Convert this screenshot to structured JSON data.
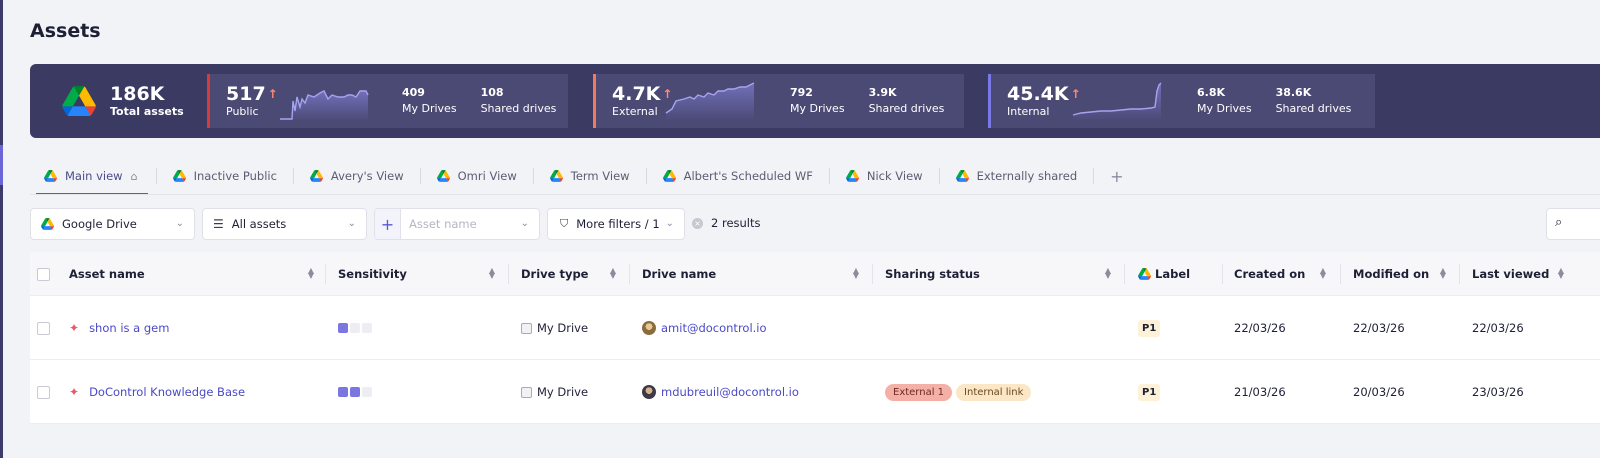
{
  "page": {
    "title": "Assets"
  },
  "colors": {
    "banner_bg": "#3b3a63",
    "public_accent": "#d63b3b",
    "external_accent": "#f07a5a",
    "internal_accent": "#7a78e6",
    "link": "#4a49c8",
    "tab_underline": "#5b57d1"
  },
  "stats": {
    "total": {
      "value": "186K",
      "label": "Total assets",
      "icon": "google-drive-logo"
    },
    "cards": [
      {
        "key": "public",
        "value": "517",
        "label": "Public",
        "trend_icon": "arrow-up",
        "sub": [
          {
            "value": "409",
            "label": "My Drives"
          },
          {
            "value": "108",
            "label": "Shared drives"
          }
        ]
      },
      {
        "key": "external",
        "value": "4.7K",
        "label": "External",
        "trend_icon": "arrow-up",
        "sub": [
          {
            "value": "792",
            "label": "My Drives"
          },
          {
            "value": "3.9K",
            "label": "Shared drives"
          }
        ]
      },
      {
        "key": "internal",
        "value": "45.4K",
        "label": "Internal",
        "trend_icon": "arrow-up",
        "sub": [
          {
            "value": "6.8K",
            "label": "My Drives"
          },
          {
            "value": "38.6K",
            "label": "Shared drives"
          }
        ]
      }
    ]
  },
  "tabs": [
    {
      "label": "Main view",
      "active": true,
      "icon": "google-drive-logo",
      "suffix_icon": "home-icon"
    },
    {
      "label": "Inactive Public",
      "icon": "google-drive-logo"
    },
    {
      "label": "Avery's View",
      "icon": "google-drive-logo"
    },
    {
      "label": "Omri View",
      "icon": "google-drive-logo"
    },
    {
      "label": "Term View",
      "icon": "google-drive-logo"
    },
    {
      "label": "Albert's Scheduled WF",
      "icon": "google-drive-logo"
    },
    {
      "label": "Nick View",
      "icon": "google-drive-logo"
    },
    {
      "label": "Externally shared",
      "icon": "google-drive-logo"
    }
  ],
  "filters": {
    "platform": "Google Drive",
    "asset_scope": "All assets",
    "asset_name_placeholder": "Asset name",
    "more_filters": "More filters / 1",
    "results": "2 results"
  },
  "table": {
    "headers": {
      "asset_name": "Asset name",
      "sensitivity": "Sensitivity",
      "drive_type": "Drive type",
      "drive_name": "Drive name",
      "sharing_status": "Sharing status",
      "label": "Label",
      "created_on": "Created on",
      "modified_on": "Modified on",
      "last_viewed": "Last viewed"
    },
    "rows": [
      {
        "asset_name": "shon is a gem",
        "sensitivity_level": 1,
        "drive_type": "My Drive",
        "drive_name": "amit@docontrol.io",
        "sharing": [],
        "label": "P1",
        "created_on": "22/03/26",
        "modified_on": "22/03/26",
        "last_viewed": "22/03/26"
      },
      {
        "asset_name": "DoControl Knowledge Base",
        "sensitivity_level": 2,
        "drive_type": "My Drive",
        "drive_name": "mdubreuil@docontrol.io",
        "sharing": [
          "External 1",
          "Internal link"
        ],
        "label": "P1",
        "created_on": "21/03/26",
        "modified_on": "20/03/26",
        "last_viewed": "23/03/26"
      }
    ]
  }
}
